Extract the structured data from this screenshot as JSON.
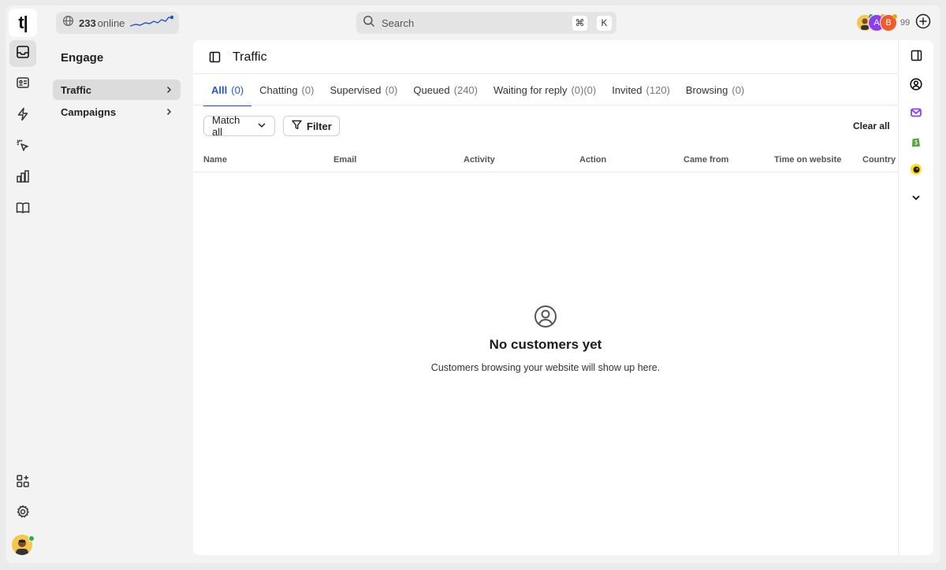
{
  "app": {
    "logo_text": "t|"
  },
  "topbar": {
    "online_count": "233",
    "online_label": "online",
    "search_placeholder": "Search",
    "shortcut_mod": "⌘",
    "shortcut_key": "K",
    "team_avatars": [
      {
        "initial": "",
        "color": "#f3c74c",
        "dot": "#2fae4f"
      },
      {
        "initial": "A",
        "color": "#8b3ff0",
        "dot": "#e9a321"
      },
      {
        "initial": "B",
        "color": "#ef5b2b",
        "dot": "#e9a321"
      }
    ],
    "team_extra_count": "99"
  },
  "nav": {
    "title": "Engage",
    "items": [
      {
        "label": "Traffic",
        "active": true
      },
      {
        "label": "Campaigns",
        "active": false
      }
    ]
  },
  "main": {
    "title": "Traffic",
    "tabs": [
      {
        "label": "Alll",
        "count": "(0)",
        "active": true
      },
      {
        "label": "Chatting",
        "count": "(0)",
        "active": false
      },
      {
        "label": "Supervised",
        "count": "(0)",
        "active": false
      },
      {
        "label": "Queued",
        "count": "(240)",
        "active": false
      },
      {
        "label": "Waiting for reply",
        "count": "(0)(0)",
        "active": false
      },
      {
        "label": "Invited",
        "count": "(120)",
        "active": false
      },
      {
        "label": "Browsing",
        "count": "(0)",
        "active": false
      }
    ],
    "match_label": "Match all",
    "filter_label": "Filter",
    "clear_label": "Clear all",
    "columns": [
      "Name",
      "Email",
      "Activity",
      "Action",
      "Came from",
      "Time on website",
      "Country"
    ],
    "empty_title": "No customers yet",
    "empty_subtitle": "Customers browsing your website will show up here."
  },
  "colors": {
    "accent": "#2457c5",
    "online": "#2fae4f"
  }
}
